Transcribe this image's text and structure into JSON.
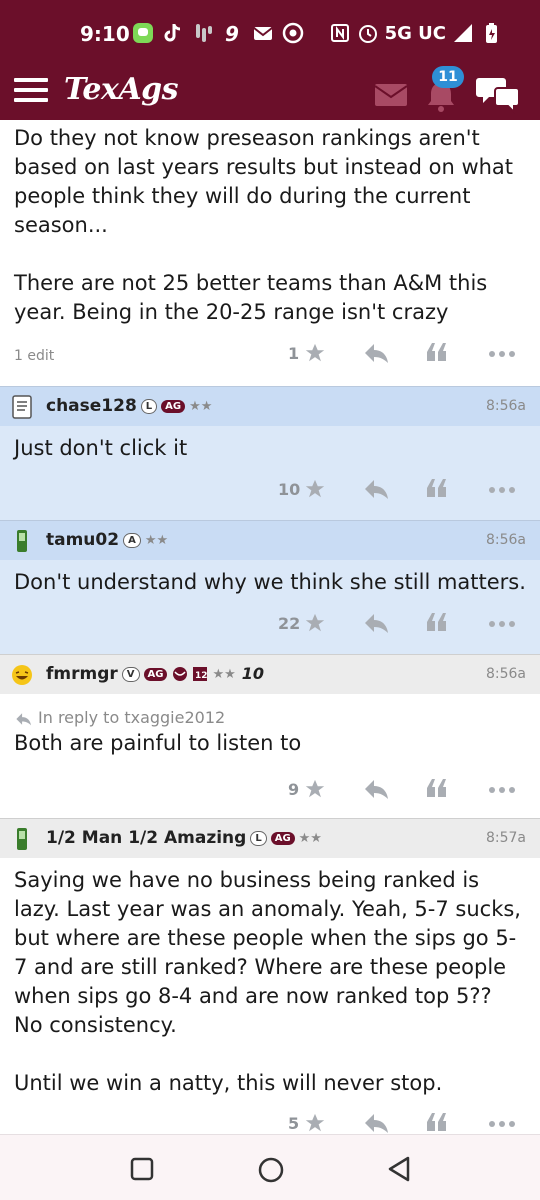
{
  "status_bar": {
    "time": "9:10",
    "network": "5G UC",
    "left_icons": [
      "messages-icon",
      "tiktok-icon",
      "slack-icon",
      "nine-icon",
      "mail-icon",
      "chrome-icon"
    ],
    "right_icons": [
      "nfc-icon",
      "alarm-icon",
      "signal-icon",
      "battery-icon"
    ]
  },
  "app_bar": {
    "logo": "TexAgs",
    "notification_count": "11",
    "accent": "#6b0f2a"
  },
  "posts": [
    {
      "body_lines": [
        "Do they not know preseason rankings aren't based on last years results but instead on what people think they will do during the current season...",
        "There are not 25 better teams than A&M this year. Being in the 20-25 range isn't crazy"
      ],
      "edit_note": "1 edit",
      "likes": "1"
    },
    {
      "user": "chase128",
      "chips": [
        "L",
        "AG"
      ],
      "stars": "★★",
      "time": "8:56a",
      "body": "Just don't click it",
      "likes": "10"
    },
    {
      "user": "tamu02",
      "chips": [
        "A"
      ],
      "stars": "★★",
      "time": "8:56a",
      "body": "Don't understand why we think she still matters.",
      "likes": "22"
    },
    {
      "user": "fmrmgr",
      "chips": [
        "V",
        "AG"
      ],
      "stars": "★★",
      "extra_badge": "10",
      "time": "8:56a",
      "reply_to": "In reply to txaggie2012",
      "body": "Both are painful to listen to",
      "likes": "9"
    },
    {
      "user": "1/2 Man 1/2 Amazing",
      "chips": [
        "L",
        "AG"
      ],
      "stars": "★★",
      "time": "8:57a",
      "body_lines": [
        "Saying we have no business being ranked is lazy. Last year was an anomaly. Yeah, 5-7 sucks, but where are these people when the sips go 5-7 and are still ranked? Where are these people when sips go 8-4 and are now ranked top 5?? No consistency.",
        "Until we win a natty, this will never stop."
      ],
      "likes": "5"
    }
  ],
  "nav": [
    "recents-button",
    "home-button",
    "back-button"
  ]
}
